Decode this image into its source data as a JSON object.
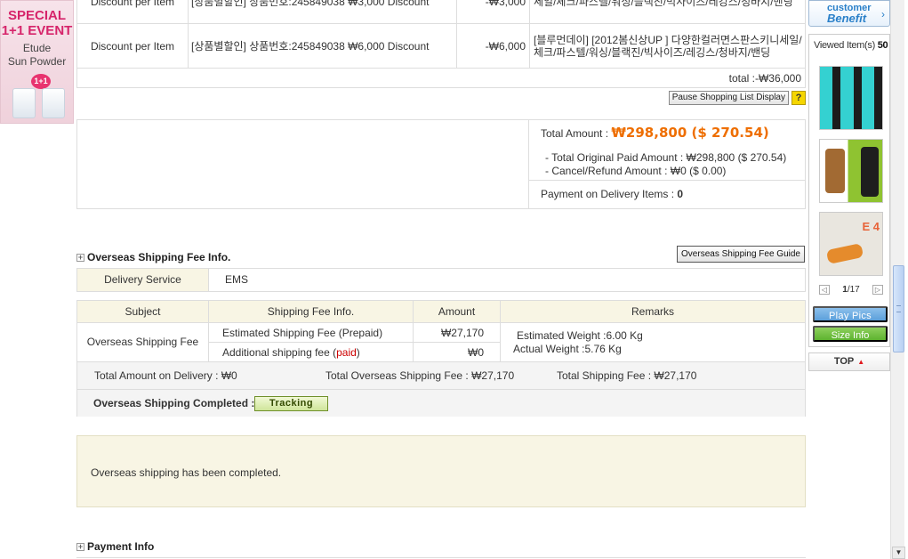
{
  "promo": {
    "line1": "SPECIAL",
    "line2": "1+1 EVENT",
    "line3": "Etude",
    "line4": "Sun Powder",
    "badge": "1+1"
  },
  "items": [
    {
      "type": "Discount per Item",
      "desc": "[상품별할인] 상품번호:245849038 ₩3,000 Discount",
      "amount": "-₩3,000",
      "product": "세일/체크/파스텔/워싱/블랙진/빅사이즈/레깅스/청바지/밴딩"
    },
    {
      "type": "Discount per Item",
      "desc": "[상품별할인] 상품번호:245849038 ₩6,000 Discount",
      "amount": "-₩6,000",
      "product": "[블루먼데이] [2012봄신상UP ] 다양한컬러면스판스키니세일/체크/파스텔/워싱/블랙진/빅사이즈/레깅스/청바지/밴딩"
    }
  ],
  "items_total": "total :-₩36,000",
  "pause_label": "Pause Shopping List Display",
  "help_label": "?",
  "amount": {
    "label": "Total Amount :",
    "value": "₩298,800 ($ 270.54)",
    "original": "- Total Original Paid Amount : ₩298,800 ($ 270.54)",
    "cancel": "- Cancel/Refund Amount : ₩0 ($ 0.00)",
    "pod_label": "Payment on Delivery Items :",
    "pod_value": "0"
  },
  "overseas": {
    "title": "Overseas Shipping Fee Info.",
    "guide_label": "Overseas Shipping Fee Guide",
    "delivery_label": "Delivery Service",
    "delivery_value": "EMS",
    "headers": [
      "Subject",
      "Shipping Fee Info.",
      "Amount",
      "Remarks"
    ],
    "subject": "Overseas Shipping Fee",
    "fee1_label": "Estimated Shipping Fee (Prepaid)",
    "fee1_amount": "₩27,170",
    "fee2_prefix": "Additional shipping fee (",
    "fee2_paid": "paid",
    "fee2_suffix": ")",
    "fee2_amount": "₩0",
    "remarks_line1": "Estimated Weight :6.00 Kg",
    "remarks_line2": "Actual Weight :5.76 Kg",
    "total_delivery": "Total Amount on Delivery : ₩0",
    "total_overseas": "Total Overseas Shipping Fee : ₩27,170",
    "total_shipping": "Total Shipping Fee : ₩27,170",
    "completed_label": "Overseas Shipping Completed :",
    "tracking_label": "Tracking",
    "notice": "Overseas shipping has been completed."
  },
  "payment_title": "Payment Info",
  "side": {
    "customer_line1": "customer",
    "customer_line2": "Benefit",
    "chevron": "›",
    "viewed_label": "Viewed Item(s)",
    "viewed_count": "50",
    "page_current": "1",
    "page_total": "/17",
    "prev": "◁",
    "next": "▷",
    "play_pics": "Play Pics",
    "size_info": "Size Info",
    "top_label": "TOP",
    "top_icon": "▲"
  },
  "colors": {
    "accent_orange": "#ee6e00",
    "paid_red": "#cc0000",
    "header_bg": "#f8f5e4"
  }
}
